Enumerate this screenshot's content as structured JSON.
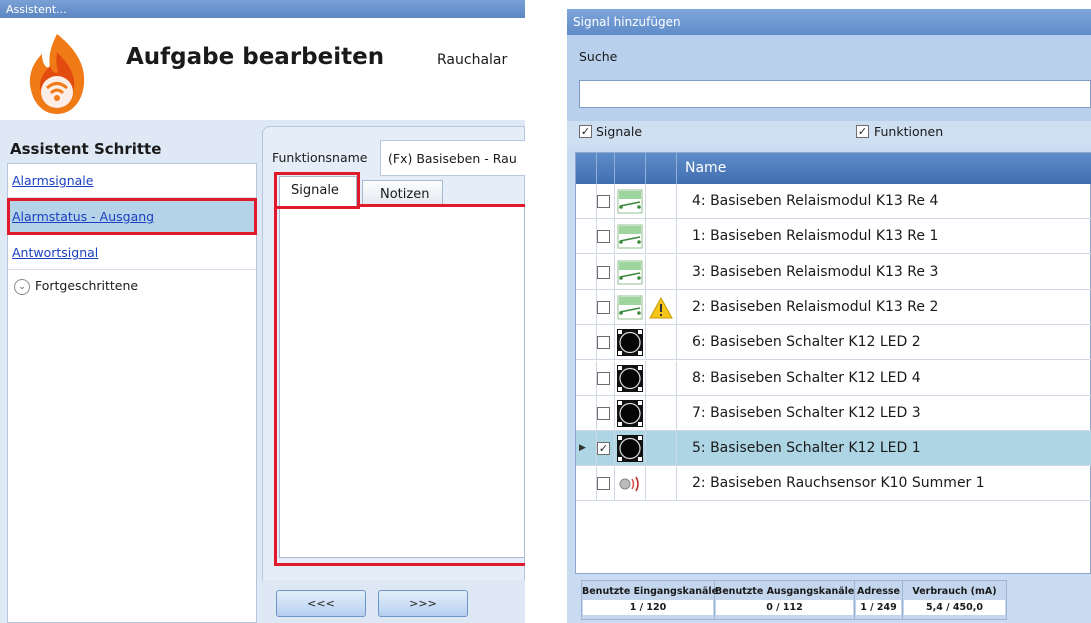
{
  "left_window": {
    "title": "Assistent...",
    "header": {
      "title": "Aufgabe bearbeiten",
      "subtitle": "Rauchalar"
    },
    "steps_title": "Assistent Schritte",
    "steps": [
      {
        "label": "Alarmsignale",
        "selected": false
      },
      {
        "label": "Alarmstatus - Ausgang",
        "selected": true
      },
      {
        "label": "Antwortsignal",
        "selected": false
      }
    ],
    "advanced_label": "Fortgeschrittene",
    "function_name_label": "Funktionsname",
    "function_name_value": "(Fx) Basiseben - Rau",
    "tabs": [
      {
        "label": "Signale",
        "active": true
      },
      {
        "label": "Notizen",
        "active": false
      }
    ],
    "buttons": {
      "back": "<<<",
      "next": ">>>"
    },
    "highlight_color": "#e01a2a"
  },
  "right_window": {
    "title": "Signal hinzufügen",
    "search_label": "Suche",
    "search_value": "",
    "filters": [
      {
        "label": "Signale",
        "checked": true
      },
      {
        "label": "Funktionen",
        "checked": true
      }
    ],
    "column_name": "Name",
    "rows": [
      {
        "name": "4: Basiseben Relaismodul K13 Re 4",
        "checked": false,
        "icon": "relay-icon",
        "warning": false,
        "selected": false
      },
      {
        "name": "1: Basiseben Relaismodul K13 Re 1",
        "checked": false,
        "icon": "relay-icon",
        "warning": false,
        "selected": false
      },
      {
        "name": "3: Basiseben Relaismodul K13 Re 3",
        "checked": false,
        "icon": "relay-icon",
        "warning": false,
        "selected": false
      },
      {
        "name": "2: Basiseben Relaismodul K13 Re 2",
        "checked": false,
        "icon": "relay-icon",
        "warning": true,
        "selected": false
      },
      {
        "name": "6: Basiseben Schalter K12 LED 2",
        "checked": false,
        "icon": "switch-led-icon",
        "warning": false,
        "selected": false
      },
      {
        "name": "8: Basiseben Schalter K12 LED 4",
        "checked": false,
        "icon": "switch-led-icon",
        "warning": false,
        "selected": false
      },
      {
        "name": "7: Basiseben Schalter K12 LED 3",
        "checked": false,
        "icon": "switch-led-icon",
        "warning": false,
        "selected": false
      },
      {
        "name": "5: Basiseben Schalter K12 LED 1",
        "checked": true,
        "icon": "switch-led-icon",
        "warning": false,
        "selected": true
      },
      {
        "name": "2: Basiseben Rauchsensor K10 Summer 1",
        "checked": false,
        "icon": "smoke-sensor-icon",
        "warning": false,
        "selected": false
      }
    ],
    "stats": [
      {
        "label": "Benutzte Eingangskanäle",
        "value": "1 / 120"
      },
      {
        "label": "Benutzte Ausgangskanäle",
        "value": "0 / 112"
      },
      {
        "label": "Adresse",
        "value": "1 / 249"
      },
      {
        "label": "Verbrauch (mA)",
        "value": "5,4 / 450,0"
      }
    ],
    "selected_row_color": "#aed5e4"
  }
}
